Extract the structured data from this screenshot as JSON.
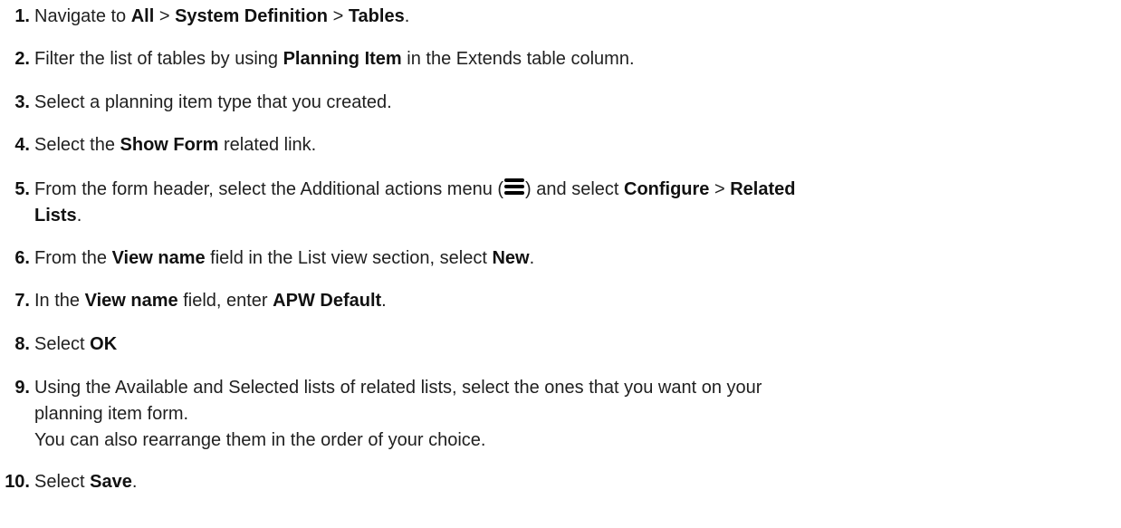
{
  "steps": [
    {
      "num": "1.",
      "t1": "Navigate to ",
      "b1": "All",
      "t2": " > ",
      "b2": "System Definition",
      "t3": " > ",
      "b3": "Tables",
      "t4": "."
    },
    {
      "num": "2.",
      "t1": "Filter the list of tables by using ",
      "b1": "Planning Item",
      "t2": " in the Extends table column."
    },
    {
      "num": "3.",
      "t1": "Select a planning item type that you created."
    },
    {
      "num": "4.",
      "t1": "Select the ",
      "b1": "Show Form",
      "t2": " related link."
    },
    {
      "num": "5.",
      "t1": "From the form header, select the Additional actions menu (",
      "icon": "hamburger-menu-icon",
      "t2": ") and select ",
      "b1": "Configure",
      "t3": " > ",
      "b2": "Related",
      "b3": "Lists",
      "t4": "."
    },
    {
      "num": "6.",
      "t1": "From the ",
      "b1": "View name",
      "t2": " field in the List view section, select ",
      "b2": "New",
      "t3": "."
    },
    {
      "num": "7.",
      "t1": "In the ",
      "b1": "View name",
      "t2": " field, enter ",
      "b2": "APW Default",
      "t3": "."
    },
    {
      "num": "8.",
      "t1": "Select ",
      "b1": "OK"
    },
    {
      "num": "9.",
      "t1": "Using the Available and Selected lists of related lists, select the ones that you want on your",
      "t2": "planning item form.",
      "t3": "You can also rearrange them in the order of your choice."
    },
    {
      "num": "10.",
      "t1": "Select ",
      "b1": "Save",
      "t2": "."
    }
  ]
}
